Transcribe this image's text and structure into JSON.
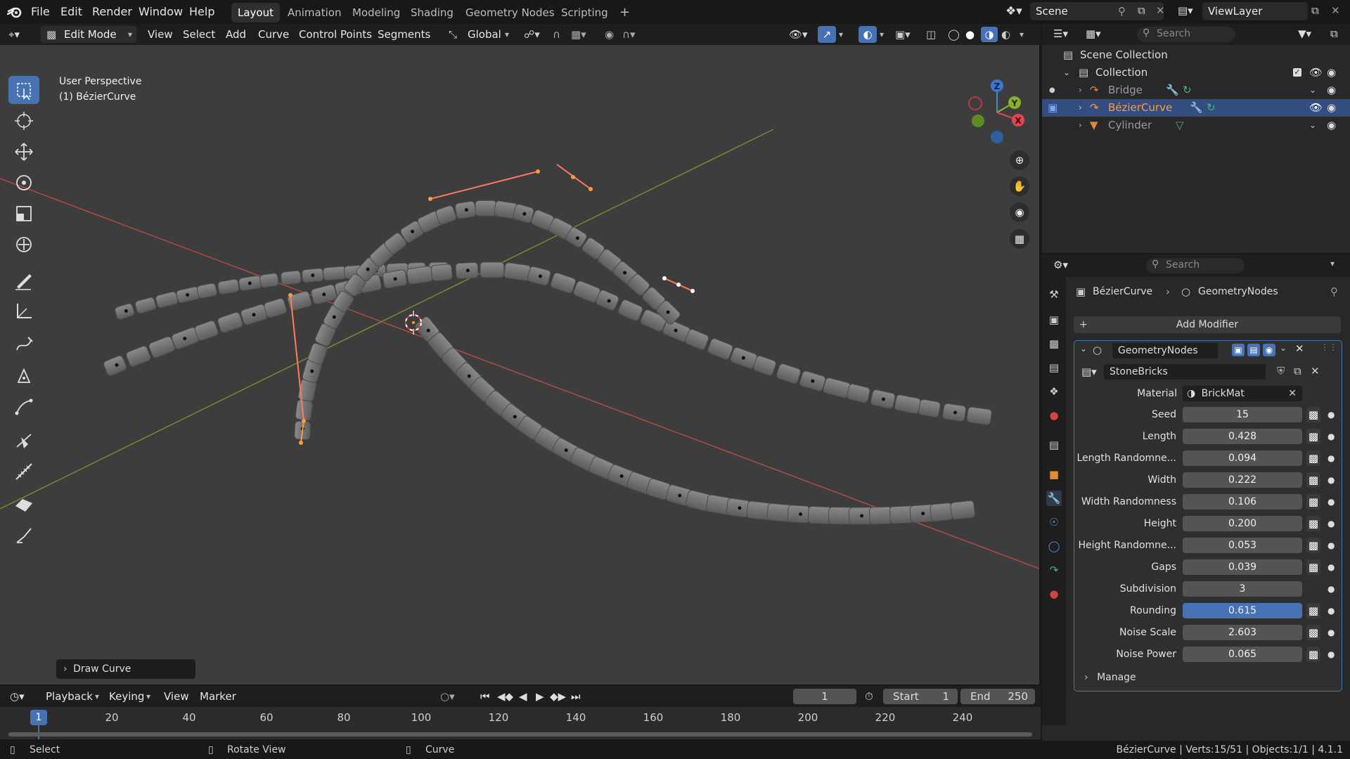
{
  "app": {
    "menus": [
      "File",
      "Edit",
      "Render",
      "Window",
      "Help"
    ],
    "workspaces": [
      "Layout",
      "Animation",
      "Modeling",
      "Shading",
      "Geometry Nodes",
      "Scripting"
    ],
    "active_workspace": "Layout",
    "scene": "Scene",
    "view_layer": "ViewLayer"
  },
  "viewport_header": {
    "mode": "Edit Mode",
    "menus": [
      "View",
      "Select",
      "Add",
      "Curve",
      "Control Points",
      "Segments"
    ],
    "transform_orientation": "Global"
  },
  "viewport": {
    "perspective_label": "User Perspective",
    "object_label": "(1) BézierCurve",
    "last_operator": "Draw Curve",
    "gizmo_axes": [
      "Z",
      "Y",
      "X"
    ]
  },
  "outliner": {
    "search_placeholder": "Search",
    "scene_collection": "Scene Collection",
    "collection": "Collection",
    "objects": [
      {
        "name": "Bridge",
        "selected": false,
        "color": "#bdbdbd"
      },
      {
        "name": "BézierCurve",
        "selected": true,
        "color": "#ff9a3c"
      },
      {
        "name": "Cylinder",
        "selected": false,
        "color": "#bdbdbd"
      }
    ]
  },
  "properties": {
    "search_placeholder": "Search",
    "breadcrumb": [
      "BézierCurve",
      "GeometryNodes"
    ],
    "add_modifier": "Add Modifier",
    "modifier_name": "GeometryNodes",
    "node_group": "StoneBricks",
    "material_label": "Material",
    "material_value": "BrickMat",
    "params": [
      {
        "label": "Seed",
        "value": "15",
        "active": false
      },
      {
        "label": "Length",
        "value": "0.428",
        "active": false
      },
      {
        "label": "Length Randomne...",
        "value": "0.094",
        "active": false
      },
      {
        "label": "Width",
        "value": "0.222",
        "active": false
      },
      {
        "label": "Width Randomness",
        "value": "0.106",
        "active": false
      },
      {
        "label": "Height",
        "value": "0.200",
        "active": false
      },
      {
        "label": "Height Randomne...",
        "value": "0.053",
        "active": false
      },
      {
        "label": "Gaps",
        "value": "0.039",
        "active": false
      },
      {
        "label": "Subdivision",
        "value": "3",
        "active": false
      },
      {
        "label": "Rounding",
        "value": "0.615",
        "active": true
      },
      {
        "label": "Noise Scale",
        "value": "2.603",
        "active": false
      },
      {
        "label": "Noise Power",
        "value": "0.065",
        "active": false
      }
    ],
    "manage_label": "Manage"
  },
  "timeline": {
    "menus": [
      "Playback",
      "Keying",
      "View",
      "Marker"
    ],
    "current_frame": "1",
    "start_label": "Start",
    "start_value": "1",
    "end_label": "End",
    "end_value": "250",
    "ruler": [
      "20",
      "40",
      "60",
      "80",
      "100",
      "120",
      "140",
      "160",
      "180",
      "200",
      "220",
      "240"
    ],
    "playhead": "1"
  },
  "statusbar": {
    "select": "Select",
    "rotate": "Rotate View",
    "curve": "Curve",
    "stats": "BézierCurve | Verts:15/51 | Objects:1/1 | 4.1.1"
  },
  "colors": {
    "accent": "#4772b3",
    "selection_orange": "#ff9a3c",
    "x_axis": "#c84a4a",
    "y_axis": "#7fa23a"
  }
}
